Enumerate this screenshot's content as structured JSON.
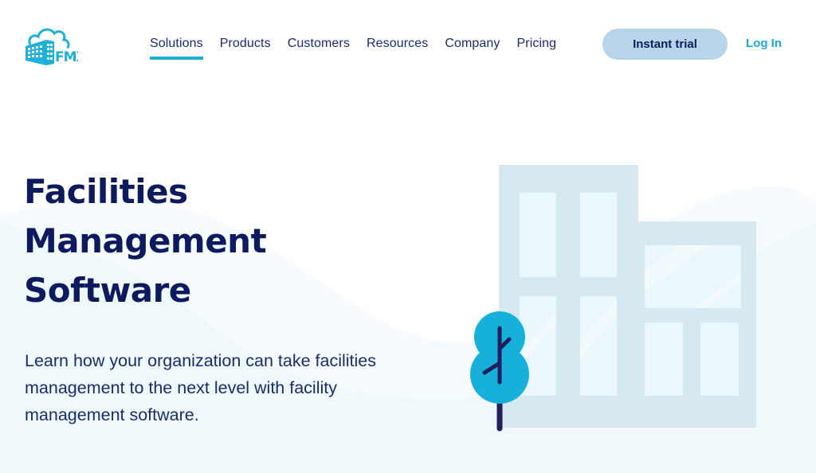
{
  "brand": {
    "name": "FMX",
    "colors": {
      "primary_dark": "#0d1a5e",
      "accent": "#1fb0d8",
      "button_bg": "#b8d4e8",
      "building": "#d6e9f1",
      "window": "#eaf7fc",
      "tree": "#16b0da",
      "trunk": "#221f5e"
    }
  },
  "header": {
    "logo_text": "FMX",
    "nav": [
      {
        "label": "Solutions",
        "active": true
      },
      {
        "label": "Products",
        "active": false
      },
      {
        "label": "Customers",
        "active": false
      },
      {
        "label": "Resources",
        "active": false
      },
      {
        "label": "Company",
        "active": false
      },
      {
        "label": "Pricing",
        "active": false
      }
    ],
    "trial_button": "Instant trial",
    "login_link": "Log In"
  },
  "hero": {
    "title_lines": [
      "Facilities",
      "Management",
      "Software"
    ],
    "description": "Learn how your organization can take facilities management to the next level with facility management software."
  },
  "illustration": {
    "subject": "office building with tree"
  }
}
